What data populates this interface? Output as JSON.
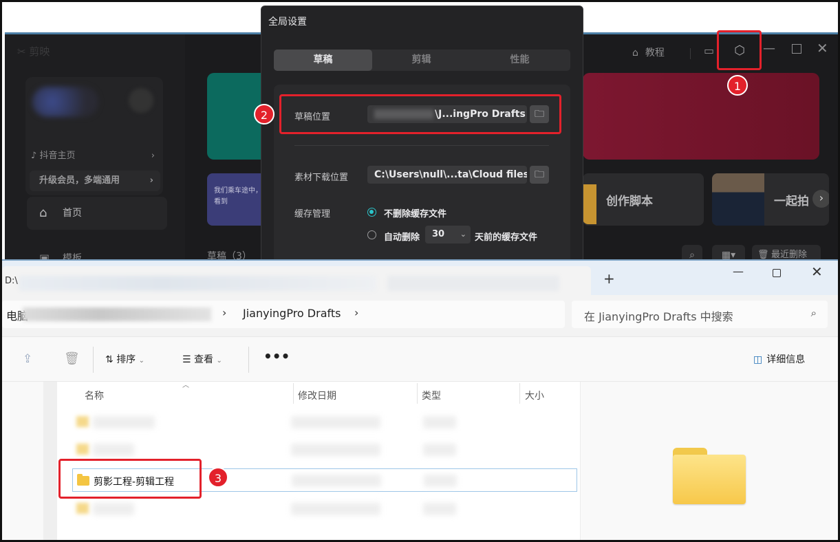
{
  "jianying": {
    "logo": "剪映",
    "douyin_home": "抖音主页",
    "vip_promo": "升级会员，多端通用",
    "nav_home": "首页",
    "nav_templates": "模板",
    "tile_text": "我们乘车途中，看到",
    "tile_script": "创作脚本",
    "tile_shoot": "一起拍",
    "drafts_label": "草稿（3）",
    "recent_delete": "最近删除",
    "tutorial": "教程"
  },
  "dialog": {
    "title": "全局设置",
    "tabs": [
      {
        "label": "草稿",
        "active": true
      },
      {
        "label": "剪辑",
        "active": false
      },
      {
        "label": "性能",
        "active": false
      }
    ],
    "draft_location_label": "草稿位置",
    "draft_location_value": "\\J...ingPro Drafts",
    "asset_download_label": "素材下载位置",
    "asset_download_value": "C:\\Users\\null\\...ta\\Cloud files",
    "cache_label": "缓存管理",
    "cache_options": {
      "keep": "不删除缓存文件",
      "auto_delete_prefix": "自动删除",
      "auto_delete_suffix": "天前的缓存文件"
    },
    "days_value": "30"
  },
  "annotations": [
    "1",
    "2",
    "3"
  ],
  "explorer": {
    "tab_path": "D:\\",
    "new_tab": "+",
    "breadcrumb_root": "电脑",
    "breadcrumb_current": "JianyingPro Drafts",
    "search_placeholder": "在 JianyingPro Drafts 中搜索",
    "toolbar": {
      "sort": "排序",
      "view": "查看",
      "more": "•••",
      "details": "详细信息"
    },
    "columns": [
      "名称",
      "修改日期",
      "类型",
      "大小"
    ],
    "selected_folder": "剪影工程-剪辑工程"
  },
  "colors": {
    "annotation_red": "#e3212b",
    "accent_teal": "#2bc4c9",
    "folder_yellow": "#f4c542"
  }
}
